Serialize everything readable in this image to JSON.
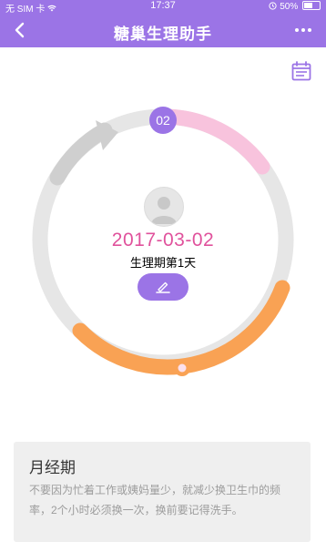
{
  "status_bar": {
    "carrier": "无 SIM 卡",
    "time": "17:37",
    "battery": "50%"
  },
  "nav": {
    "title": "糖巢生理助手",
    "back_icon": "chevron-left-icon",
    "more_icon": "more-dots-icon"
  },
  "calendar_icon": "calendar-icon",
  "cycle": {
    "day_badge": "02",
    "date": "2017-03-02",
    "phase": "生理期第1天",
    "edit_icon": "pencil-icon",
    "colors": {
      "period": "#f9a254",
      "upcoming": "#f8c3dd",
      "base": "#e6e6e6",
      "past": "#cfcfcf",
      "accent": "#9b74e6",
      "date": "#e0529c"
    }
  },
  "info": {
    "title": "月经期",
    "text": "不要因为忙着工作或姨妈量少，就减少换卫生巾的频率，2个小时必须换一次，换前要记得洗手。"
  }
}
